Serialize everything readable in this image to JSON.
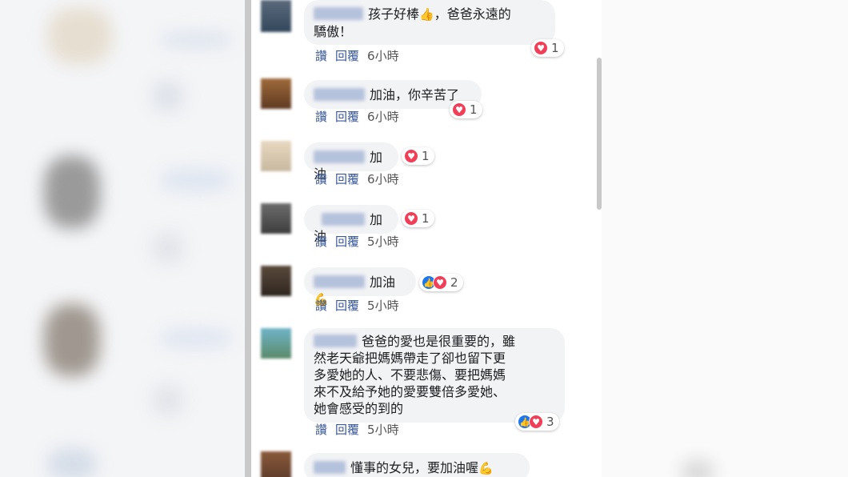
{
  "colors": {
    "link": "#385898",
    "love": "#f33e58",
    "like": "#1877f2",
    "bubble": "#f2f3f5"
  },
  "comments": [
    {
      "text": "孩子好棒👍，爸爸永遠的驕傲！",
      "line1": "孩子好棒",
      "emoji1": "👍",
      "line1b": "，爸爸永遠的",
      "line2": "驕傲！",
      "like": "讚",
      "reply": "回覆",
      "time": "6小時",
      "reaction_count": "1",
      "reactions": [
        "love"
      ]
    },
    {
      "text": "加油，你辛苦了",
      "like": "讚",
      "reply": "回覆",
      "time": "6小時",
      "reaction_count": "1",
      "reactions": [
        "love"
      ]
    },
    {
      "text": "加油",
      "like": "讚",
      "reply": "回覆",
      "time": "6小時",
      "reaction_count": "1",
      "reactions": [
        "love"
      ]
    },
    {
      "text": "加油",
      "like": "讚",
      "reply": "回覆",
      "time": "5小時",
      "reaction_count": "1",
      "reactions": [
        "love"
      ]
    },
    {
      "text": "加油",
      "emoji": "💪",
      "like": "讚",
      "reply": "回覆",
      "time": "5小時",
      "reaction_count": "2",
      "reactions": [
        "like",
        "love"
      ]
    },
    {
      "line1": "爸爸的愛也是很重要的，雖",
      "line2": "然老天爺把媽媽帶走了卻也留下更",
      "line3": "多愛她的人、不要悲傷、要把媽媽",
      "line4": "來不及給予她的愛要雙倍多愛她、",
      "line5": "她會感受的到的",
      "like": "讚",
      "reply": "回覆",
      "time": "5小時",
      "reaction_count": "3",
      "reactions": [
        "like",
        "love"
      ]
    },
    {
      "text": "懂事的女兒，要加油喔",
      "emoji": "💪"
    }
  ]
}
